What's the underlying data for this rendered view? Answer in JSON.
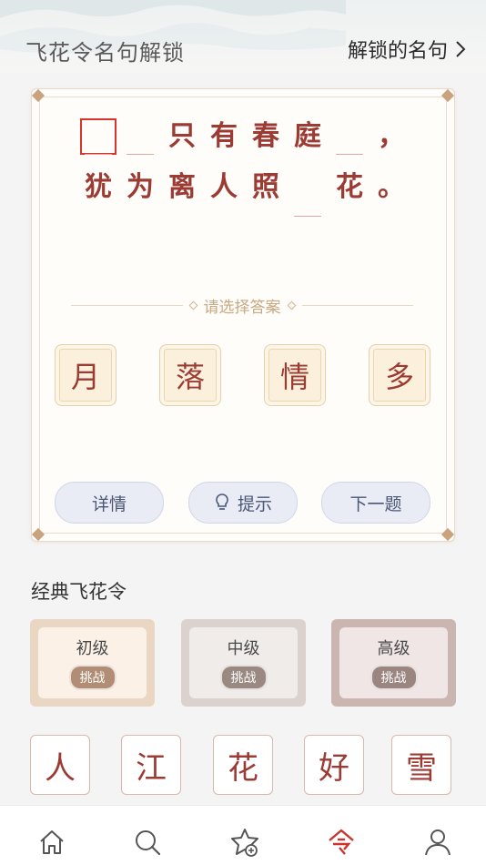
{
  "header": {
    "title": "飞花令名句解锁",
    "unlocked_link": "解锁的名句",
    "chevron": "›"
  },
  "puzzle": {
    "line1": [
      "",
      "",
      "只",
      "有",
      "春",
      "庭",
      "",
      "，"
    ],
    "line2": [
      "犹",
      "为",
      "离",
      "人",
      "照",
      "",
      "花",
      "。"
    ],
    "select_label": "请选择答案",
    "choices": [
      "月",
      "落",
      "情",
      "多"
    ],
    "actions": {
      "details": "详情",
      "hint": "提示",
      "next": "下一题"
    }
  },
  "classic": {
    "title": "经典飞花令",
    "levels": [
      {
        "name": "初级",
        "badge": "挑战"
      },
      {
        "name": "中级",
        "badge": "挑战"
      },
      {
        "name": "高级",
        "badge": "挑战"
      }
    ],
    "chars": [
      "人",
      "江",
      "花",
      "好",
      "雪"
    ]
  },
  "nav": {
    "items": [
      {
        "icon": "home-icon"
      },
      {
        "icon": "search-icon"
      },
      {
        "icon": "star-add-icon"
      },
      {
        "icon": "ling-icon",
        "active": true
      },
      {
        "icon": "user-icon"
      }
    ]
  },
  "colors": {
    "accent": "#c9342c",
    "poem_text": "#9c3b34",
    "choice_bg": "#fbf0dc",
    "level1": "#e8d4c0",
    "level2": "#d9cdc8",
    "level3": "#c8b1ad"
  }
}
